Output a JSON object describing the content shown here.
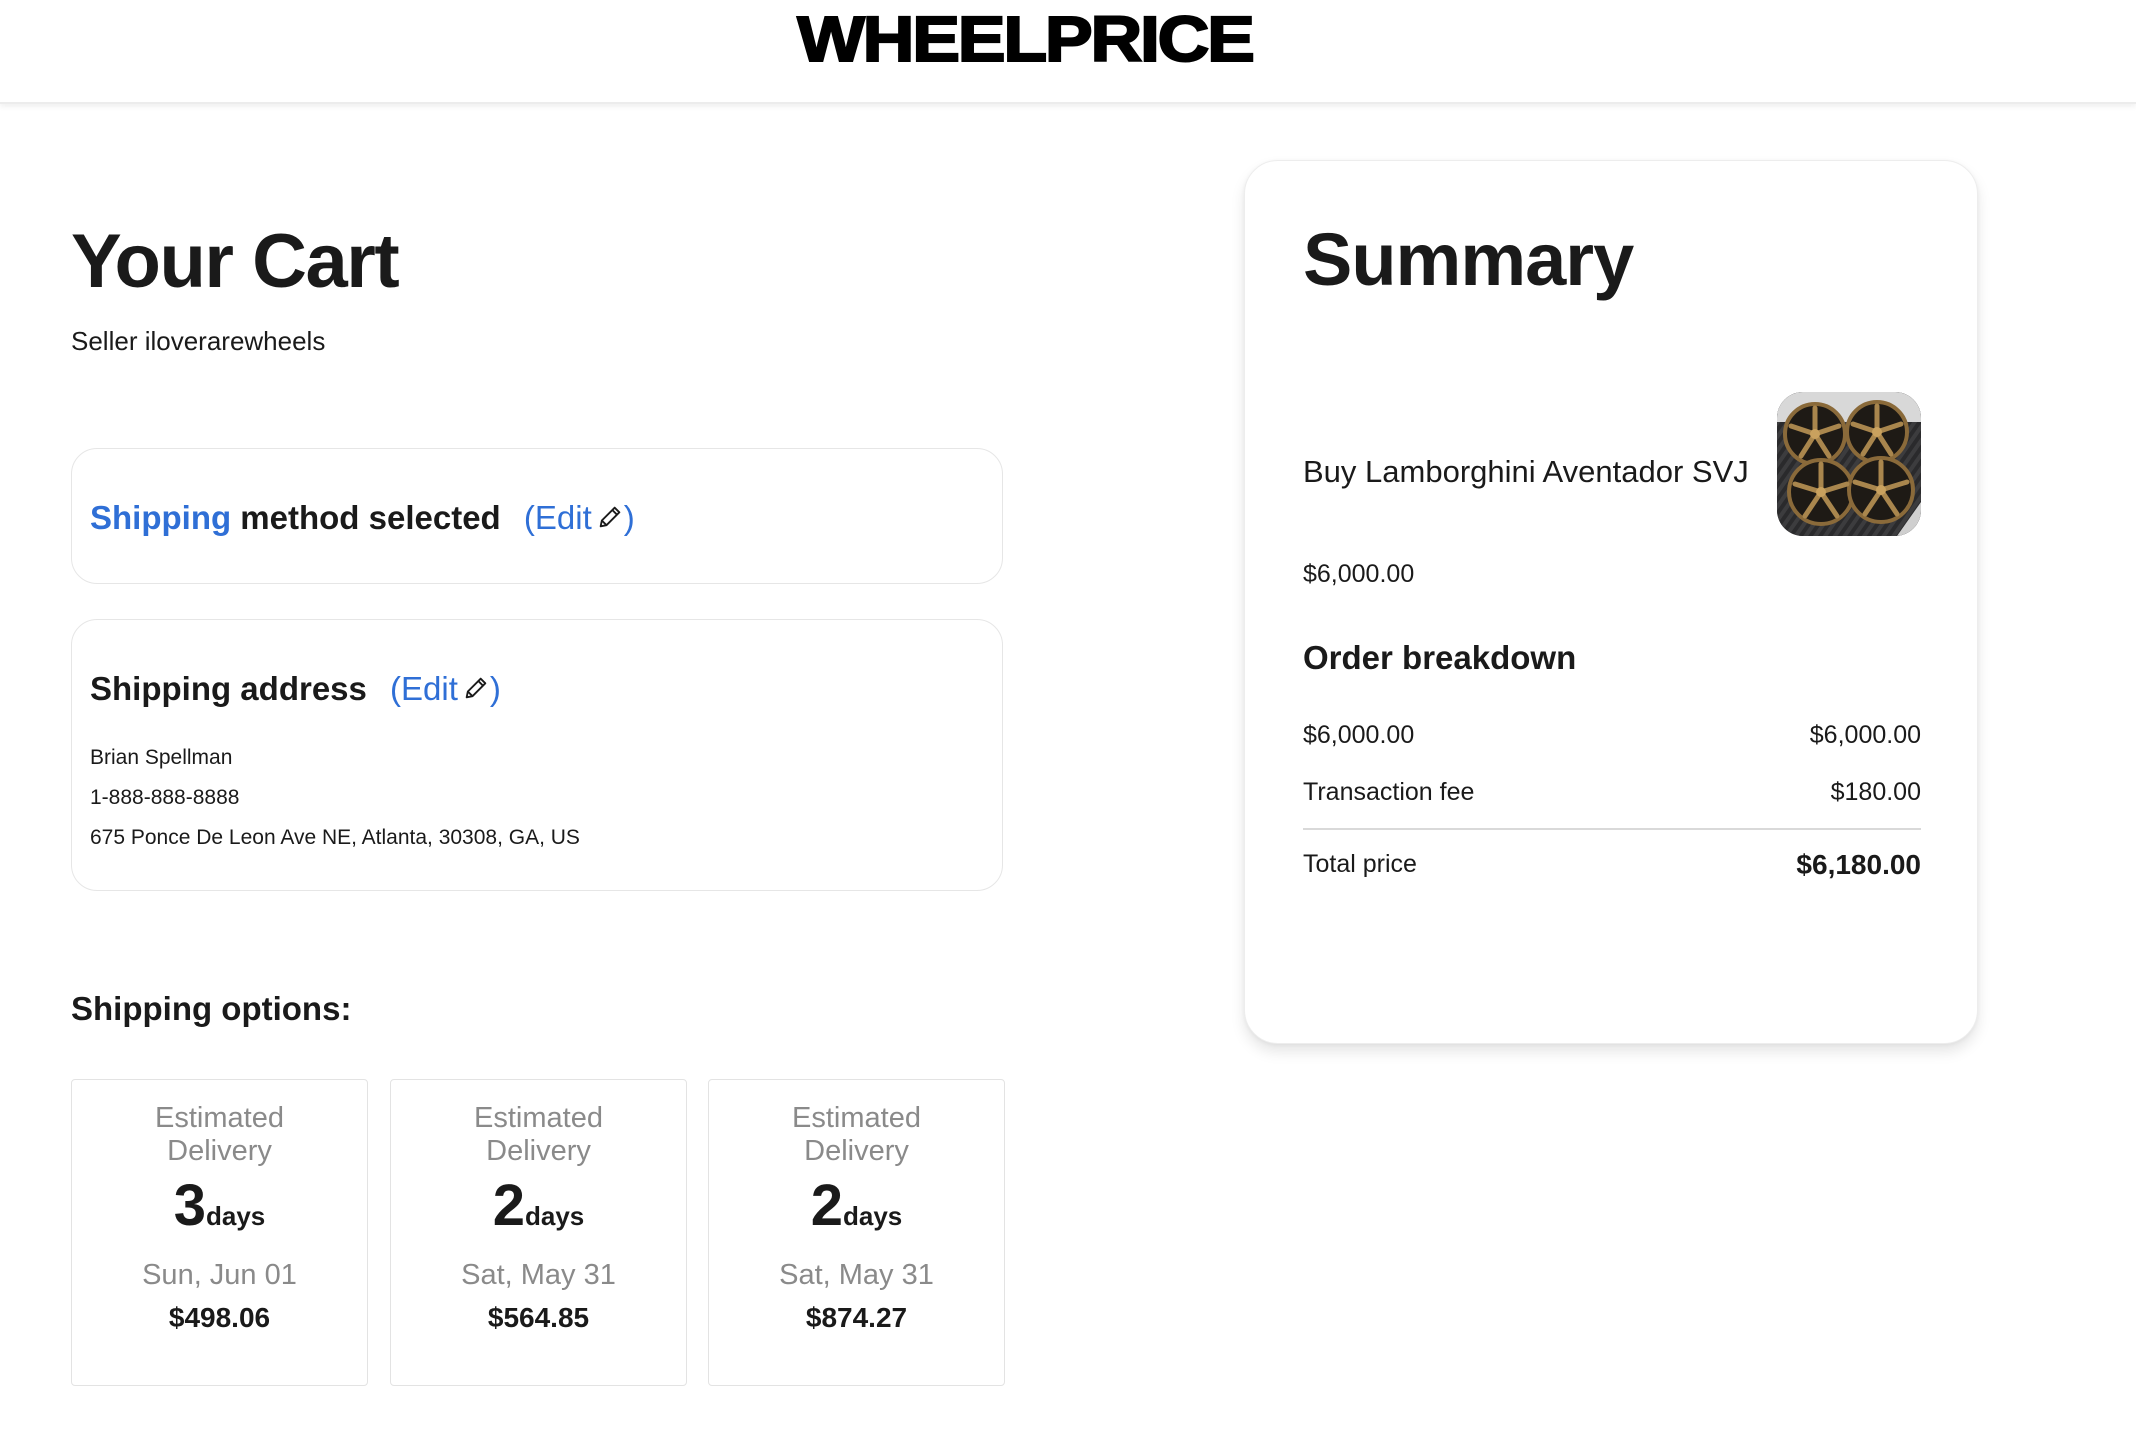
{
  "header": {
    "logo": "WHEELPRICE"
  },
  "cart": {
    "title": "Your Cart",
    "seller": "Seller iloverarewheels"
  },
  "shipping_method": {
    "label_accent": "Shipping",
    "label_rest": " method selected",
    "edit_open": "(Edit",
    "edit_close": ")"
  },
  "shipping_address": {
    "label": "Shipping address",
    "edit_open": "(Edit",
    "edit_close": ")",
    "lines": [
      "Brian Spellman",
      "1-888-888-8888",
      "675 Ponce De Leon Ave NE, Atlanta, 30308, GA, US"
    ]
  },
  "shipping_options": {
    "title": "Shipping options:",
    "options": [
      {
        "est_line1": "Estimated",
        "est_line2": "Delivery",
        "days": "3",
        "unit": "days",
        "date": "Sun, Jun 01",
        "price": "$498.06"
      },
      {
        "est_line1": "Estimated",
        "est_line2": "Delivery",
        "days": "2",
        "unit": "days",
        "date": "Sat, May 31",
        "price": "$564.85"
      },
      {
        "est_line1": "Estimated",
        "est_line2": "Delivery",
        "days": "2",
        "unit": "days",
        "date": "Sat, May 31",
        "price": "$874.27"
      }
    ]
  },
  "summary": {
    "title": "Summary",
    "product_name": "Buy Lamborghini Aventador SVJ",
    "product_price": "$6,000.00",
    "breakdown_title": "Order breakdown",
    "rows": [
      {
        "label": "$6,000.00",
        "value": "$6,000.00"
      },
      {
        "label": "Transaction fee",
        "value": "$180.00"
      }
    ],
    "total": {
      "label": "Total price",
      "value": "$6,180.00"
    }
  },
  "colors": {
    "accent": "#2f6fd6",
    "text": "#1a1a1a",
    "muted": "#8a8a8a",
    "border": "#e6e6e6"
  },
  "icons": [
    "pencil-icon",
    "wheels-product-image"
  ]
}
